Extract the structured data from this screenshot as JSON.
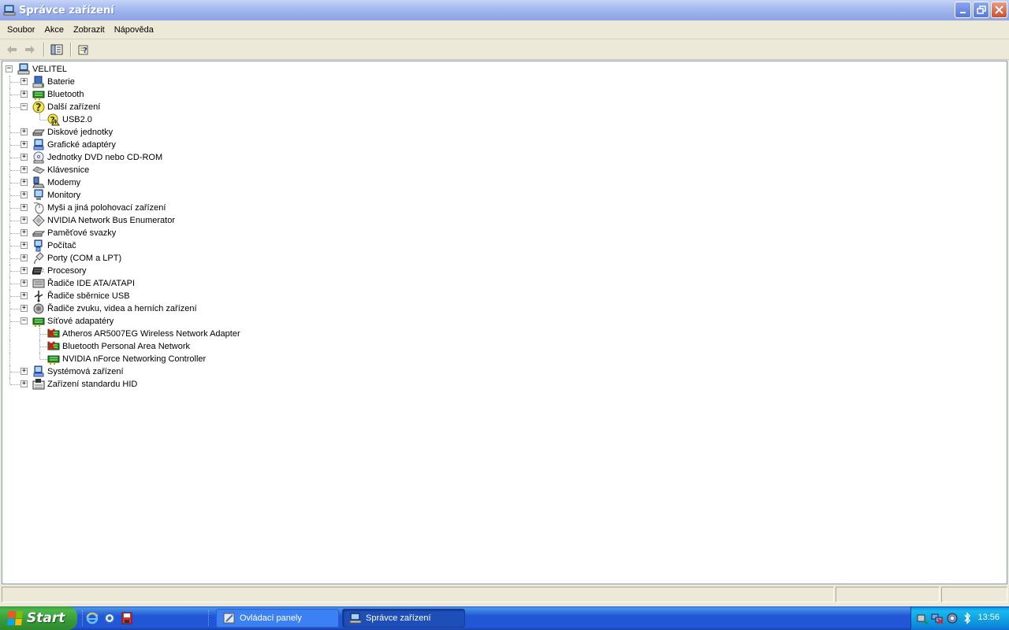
{
  "window": {
    "title": "Správce zařízení",
    "icon": "computer-manage-icon"
  },
  "menu": {
    "items": [
      "Soubor",
      "Akce",
      "Zobrazit",
      "Nápověda"
    ]
  },
  "toolbar": {
    "buttons": [
      "back-arrow-icon",
      "forward-arrow-icon",
      "show-hide-console-tree-icon",
      "help-icon"
    ]
  },
  "tree": {
    "root": "VELITEL",
    "nodes": [
      {
        "label": "Baterie",
        "icon": "battery-icon",
        "expanded": false
      },
      {
        "label": "Bluetooth",
        "icon": "bluetooth-network-icon",
        "expanded": false
      },
      {
        "label": "Další zařízení",
        "icon": "unknown-device-icon",
        "expanded": true
      },
      {
        "label": "USB2.0",
        "icon": "warning-device-icon",
        "child": true
      },
      {
        "label": "Diskové jednotky",
        "icon": "disk-drive-icon",
        "expanded": false
      },
      {
        "label": "Grafické adaptéry",
        "icon": "display-adapter-icon",
        "expanded": false
      },
      {
        "label": "Jednotky DVD nebo CD-ROM",
        "icon": "cdrom-icon",
        "expanded": false
      },
      {
        "label": "Klávesnice",
        "icon": "keyboard-icon",
        "expanded": false
      },
      {
        "label": "Modemy",
        "icon": "modem-icon",
        "expanded": false
      },
      {
        "label": "Monitory",
        "icon": "monitor-icon",
        "expanded": false
      },
      {
        "label": "Myši a jiná polohovací zařízení",
        "icon": "mouse-icon",
        "expanded": false
      },
      {
        "label": "NVIDIA Network Bus Enumerator",
        "icon": "bus-enumerator-icon",
        "expanded": false
      },
      {
        "label": "Paměťové svazky",
        "icon": "storage-volume-icon",
        "expanded": false
      },
      {
        "label": "Počítač",
        "icon": "computer-icon",
        "expanded": false
      },
      {
        "label": "Porty (COM a LPT)",
        "icon": "port-icon",
        "expanded": false
      },
      {
        "label": "Procesory",
        "icon": "processor-icon",
        "expanded": false
      },
      {
        "label": "Řadiče IDE ATA/ATAPI",
        "icon": "ide-controller-icon",
        "expanded": false
      },
      {
        "label": "Řadiče sběrnice USB",
        "icon": "usb-icon",
        "expanded": false
      },
      {
        "label": "Řadiče zvuku, videa a herních zařízení",
        "icon": "sound-icon",
        "expanded": false
      },
      {
        "label": "Síťové adapatéry",
        "icon": "network-adapter-icon",
        "expanded": true
      },
      {
        "label": "Atheros AR5007EG Wireless Network Adapter",
        "icon": "disabled-network-adapter-icon",
        "child": true
      },
      {
        "label": "Bluetooth Personal Area Network",
        "icon": "disabled-network-adapter-icon",
        "child": true
      },
      {
        "label": "NVIDIA nForce Networking Controller",
        "icon": "network-adapter-icon",
        "child": true
      },
      {
        "label": "Systémová zařízení",
        "icon": "system-device-icon",
        "expanded": false
      },
      {
        "label": "Zařízení standardu HID",
        "icon": "hid-icon",
        "expanded": false
      }
    ]
  },
  "taskbar": {
    "start_label": "Start",
    "tasks": [
      {
        "label": "Ovládací panely",
        "icon": "control-panel-icon"
      },
      {
        "label": "Správce zařízení",
        "icon": "computer-manage-icon",
        "active": true
      }
    ],
    "quicklaunch": [
      "internet-explorer-icon",
      "ie-alt-icon",
      "save-icon"
    ],
    "tray_icons": [
      "safely-remove-icon",
      "network-disconnected-icon",
      "volume-icon",
      "bluetooth-icon"
    ],
    "clock": "13:56"
  },
  "colors": {
    "title_gradient_top": "#c6d3f7",
    "taskbar_blue": "#2157d7",
    "start_green": "#3b9b3b",
    "chrome_bg": "#ece9d8"
  }
}
